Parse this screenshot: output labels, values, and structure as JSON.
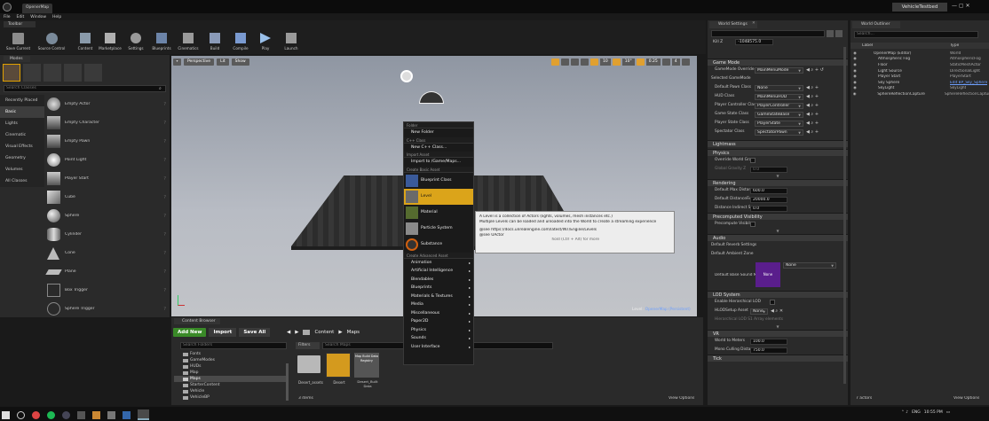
{
  "top": {
    "tab": "OpenerMap",
    "project": "VehicleTestbed",
    "menu": [
      "File",
      "Edit",
      "Window",
      "Help"
    ]
  },
  "toolbar": {
    "tab": "Toolbar",
    "buttons": [
      "Save Current",
      "Source Control",
      "Content",
      "Marketplace",
      "Settings",
      "Blueprints",
      "Cinematics",
      "Build",
      "Compile",
      "Play",
      "Launch"
    ]
  },
  "modes": {
    "tab": "Modes",
    "search": "Search Classes",
    "categories": [
      "Recently Placed",
      "Basic",
      "Lights",
      "Cinematic",
      "Visual Effects",
      "Geometry",
      "Volumes",
      "All Classes"
    ],
    "active": "Basic",
    "items": [
      "Empty Actor",
      "Empty Character",
      "Empty Pawn",
      "Point Light",
      "Player Start",
      "Cube",
      "Sphere",
      "Cylinder",
      "Cone",
      "Plane",
      "Box Trigger",
      "Sphere Trigger"
    ]
  },
  "viewport": {
    "perspective": "Perspective",
    "lit": "Lit",
    "show": "Show",
    "snap": "10",
    "angle": "10°",
    "scale": "0.25",
    "cam": "4",
    "level": "Level:",
    "levelname": "OpenerMap (Persistent)"
  },
  "menu": {
    "sections": [
      {
        "h": "Folder",
        "items": [
          "New Folder"
        ]
      },
      {
        "h": "C++ Class",
        "items": [
          "New C++ Class..."
        ]
      },
      {
        "h": "Import Asset",
        "items": [
          "Import to /Game/Maps..."
        ]
      },
      {
        "h": "Create Basic Asset",
        "items": [
          "Blueprint Class",
          "Level",
          "Material",
          "Particle System",
          "Substance"
        ]
      },
      {
        "h": "Create Advanced Asset",
        "items": [
          "Animation",
          "Artificial Intelligence",
          "Blendables",
          "Blueprints",
          "Materials & Textures",
          "Media",
          "Miscellaneous",
          "Paper2D",
          "Physics",
          "Sounds",
          "User Interface"
        ]
      }
    ]
  },
  "tooltip": {
    "line1": "A Level is a collection of Actors (lights, volumes, mesh instances etc.)",
    "line2": "Multiple Levels can be loaded and unloaded into the World to create a streaming experience",
    "line3": "@see https://docs.unrealengine.com/latest/INT/Engine/Levels",
    "line4": "@see UActor",
    "hint": "hold (Ctrl + Alt) for more"
  },
  "content": {
    "tab": "Content Browser",
    "addnew": "Add New",
    "import": "Import",
    "saveall": "Save All",
    "crumbs": [
      "Content",
      "Maps"
    ],
    "search_folders": "Search Folders",
    "filters": "Filters",
    "search_maps": "Search Maps",
    "tree": [
      "Fonts",
      "GameModes",
      "HUDs",
      "Map",
      "Maps",
      "StarterContent",
      "Vehicle",
      "VehicleBP"
    ],
    "assets": [
      "Desert_assets",
      "Desert",
      "Desert_Built Data"
    ],
    "badge": "Map Build Data Registry",
    "count": "3 items",
    "view": "View Options"
  },
  "world": {
    "tab": "World Settings",
    "kill_z_label": "Kill Z",
    "kill_z": "-1048575.0",
    "gamemode_hdr": "Game Mode",
    "rows": [
      [
        "GameMode Override",
        "MainMenuMode"
      ],
      [
        "Selected GameMode",
        ""
      ],
      [
        "Default Pawn Class",
        "None"
      ],
      [
        "HUD Class",
        "MainMenuHUD"
      ],
      [
        "Player Controller Class",
        "PlayerController"
      ],
      [
        "Game State Class",
        "GameStateBase"
      ],
      [
        "Player State Class",
        "PlayerState"
      ],
      [
        "Spectator Class",
        "SpectatorPawn"
      ]
    ],
    "lightmass": "Lightmass",
    "physics": "Physics",
    "override_gravity": "Override World Gravity",
    "global_gravity": "Global Gravity Z",
    "gravity_val": "0.0",
    "rendering": "Rendering",
    "render_rows": [
      [
        "Default Max Distance",
        "600.0"
      ],
      [
        "Default DistanceField",
        "20000.0"
      ],
      [
        "Distance Indirect Sh",
        "0.0"
      ]
    ],
    "precomputed": "Precomputed Visibility",
    "precompute": "Precompute Visibility",
    "audio": "Audio",
    "reverb": "Default Reverb Settings",
    "ambient": "Default Ambient Zone",
    "basesound": "Default Base Sound Mix",
    "none": "None",
    "lod": "LOD System",
    "enable_hier": "Enable Hierarchical LOD",
    "hlod": "HLODSetup Asset",
    "hlod_val": "None",
    "hier_lod": "Hierarchical LOD Se",
    "hier_val": "1 Array elements",
    "vr": "VR",
    "w2m": "World to Meters",
    "w2m_val": "100.0",
    "mono": "Mono Culling Distance",
    "mono_val": "750.0",
    "tick": "Tick"
  },
  "outliner": {
    "tab": "World Outliner",
    "search": "Search...",
    "col_label": "Label",
    "col_type": "Type",
    "rows": [
      [
        "OpenerMap (Editor)",
        "World"
      ],
      [
        "Atmospheric Fog",
        "AtmosphericFog"
      ],
      [
        "Floor",
        "StaticMeshActor"
      ],
      [
        "Light Source",
        "DirectionalLight"
      ],
      [
        "Player Start",
        "PlayerStart"
      ],
      [
        "Sky Sphere",
        "Edit BP_Sky_Sphere"
      ],
      [
        "SkyLight",
        "SkyLight"
      ],
      [
        "SphereReflectionCapture",
        "SphereReflectionCapture"
      ]
    ],
    "count": "7 actors",
    "view": "View Options"
  },
  "taskbar": {
    "lang": "ENG",
    "time": "10:55 PM"
  }
}
